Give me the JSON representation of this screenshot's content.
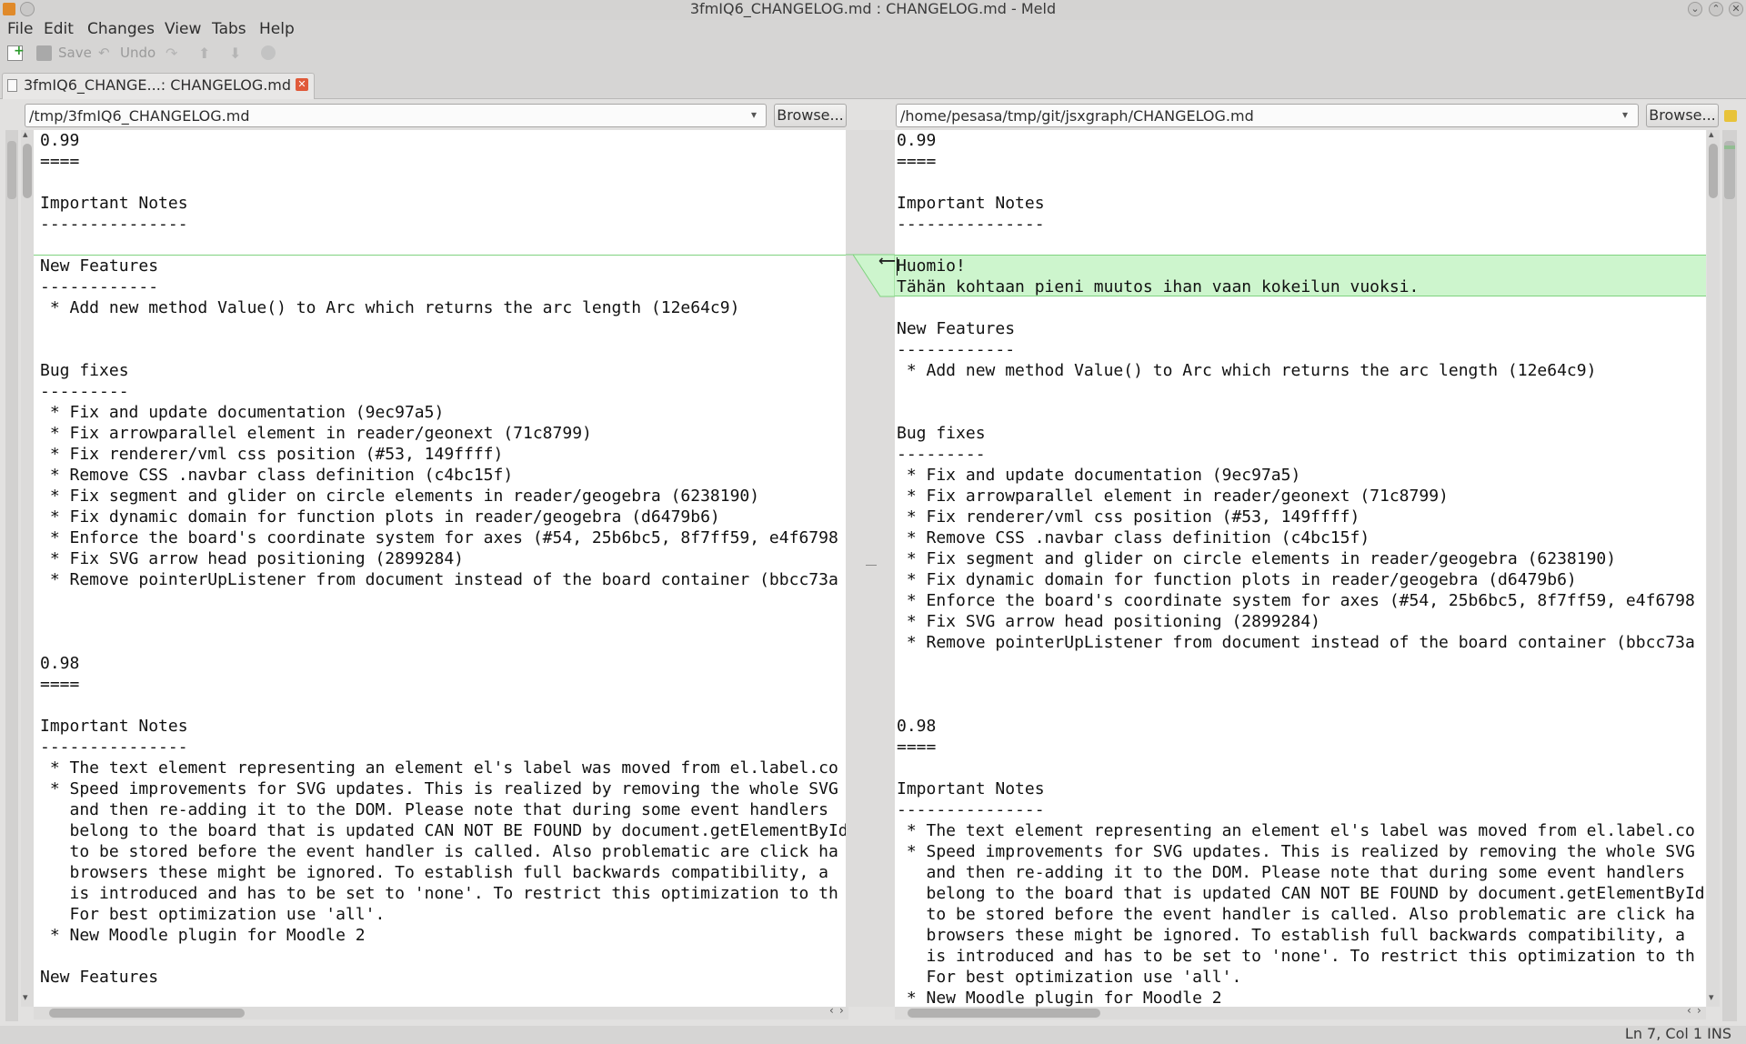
{
  "window": {
    "title": "3fmIQ6_CHANGELOG.md : CHANGELOG.md - Meld"
  },
  "menu": [
    "File",
    "Edit",
    "Changes",
    "View",
    "Tabs",
    "Help"
  ],
  "toolbar": {
    "save_label": "Save",
    "undo_label": "Undo"
  },
  "tab": {
    "label": "3fmIQ6_CHANGE...: CHANGELOG.md"
  },
  "left": {
    "path": "/tmp/3fmIQ6_CHANGELOG.md",
    "browse_label": "Browse...",
    "lines": [
      "0.99",
      "====",
      "",
      "Important Notes",
      "---------------",
      "",
      "New Features",
      "------------",
      " * Add new method Value() to Arc which returns the arc length (12e64c9)",
      "",
      "",
      "Bug fixes",
      "---------",
      " * Fix and update documentation (9ec97a5)",
      " * Fix arrowparallel element in reader/geonext (71c8799)",
      " * Fix renderer/vml css position (#53, 149ffff)",
      " * Remove CSS .navbar class definition (c4bc15f)",
      " * Fix segment and glider on circle elements in reader/geogebra (6238190)",
      " * Fix dynamic domain for function plots in reader/geogebra (d6479b6)",
      " * Enforce the board's coordinate system for axes (#54, 25b6bc5, 8f7ff59, e4f6798",
      " * Fix SVG arrow head positioning (2899284)",
      " * Remove pointerUpListener from document instead of the board container (bbcc73a",
      "",
      "",
      "",
      "0.98",
      "====",
      "",
      "Important Notes",
      "---------------",
      " * The text element representing an element el's label was moved from el.label.co",
      " * Speed improvements for SVG updates. This is realized by removing the whole SVG",
      "   and then re-adding it to the DOM. Please note that during some event handlers",
      "   belong to the board that is updated CAN NOT BE FOUND by document.getElementById",
      "   to be stored before the event handler is called. Also problematic are click ha",
      "   browsers these might be ignored. To establish full backwards compatibility, a",
      "   is introduced and has to be set to 'none'. To restrict this optimization to th",
      "   For best optimization use 'all'.",
      " * New Moodle plugin for Moodle 2",
      "",
      "New Features"
    ]
  },
  "right": {
    "path": "/home/pesasa/tmp/git/jsxgraph/CHANGELOG.md",
    "browse_label": "Browse...",
    "lines": [
      "0.99",
      "====",
      "",
      "Important Notes",
      "---------------",
      "",
      "Huomio!",
      "Tähän kohtaan pieni muutos ihan vaan kokeilun vuoksi.",
      "",
      "New Features",
      "------------",
      " * Add new method Value() to Arc which returns the arc length (12e64c9)",
      "",
      "",
      "Bug fixes",
      "---------",
      " * Fix and update documentation (9ec97a5)",
      " * Fix arrowparallel element in reader/geonext (71c8799)",
      " * Fix renderer/vml css position (#53, 149ffff)",
      " * Remove CSS .navbar class definition (c4bc15f)",
      " * Fix segment and glider on circle elements in reader/geogebra (6238190)",
      " * Fix dynamic domain for function plots in reader/geogebra (d6479b6)",
      " * Enforce the board's coordinate system for axes (#54, 25b6bc5, 8f7ff59, e4f6798",
      " * Fix SVG arrow head positioning (2899284)",
      " * Remove pointerUpListener from document instead of the board container (bbcc73a",
      "",
      "",
      "",
      "0.98",
      "====",
      "",
      "Important Notes",
      "---------------",
      " * The text element representing an element el's label was moved from el.label.co",
      " * Speed improvements for SVG updates. This is realized by removing the whole SVG",
      "   and then re-adding it to the DOM. Please note that during some event handlers",
      "   belong to the board that is updated CAN NOT BE FOUND by document.getElementById",
      "   to be stored before the event handler is called. Also problematic are click ha",
      "   browsers these might be ignored. To establish full backwards compatibility, a",
      "   is introduced and has to be set to 'none'. To restrict this optimization to th",
      "   For best optimization use 'all'.",
      " * New Moodle plugin for Moodle 2"
    ],
    "inserted_lines": [
      6,
      7
    ]
  },
  "status": {
    "text": "Ln 7, Col 1  INS"
  },
  "colors": {
    "insert_bg": "#cdf5cd",
    "insert_line": "#7fd27f"
  }
}
